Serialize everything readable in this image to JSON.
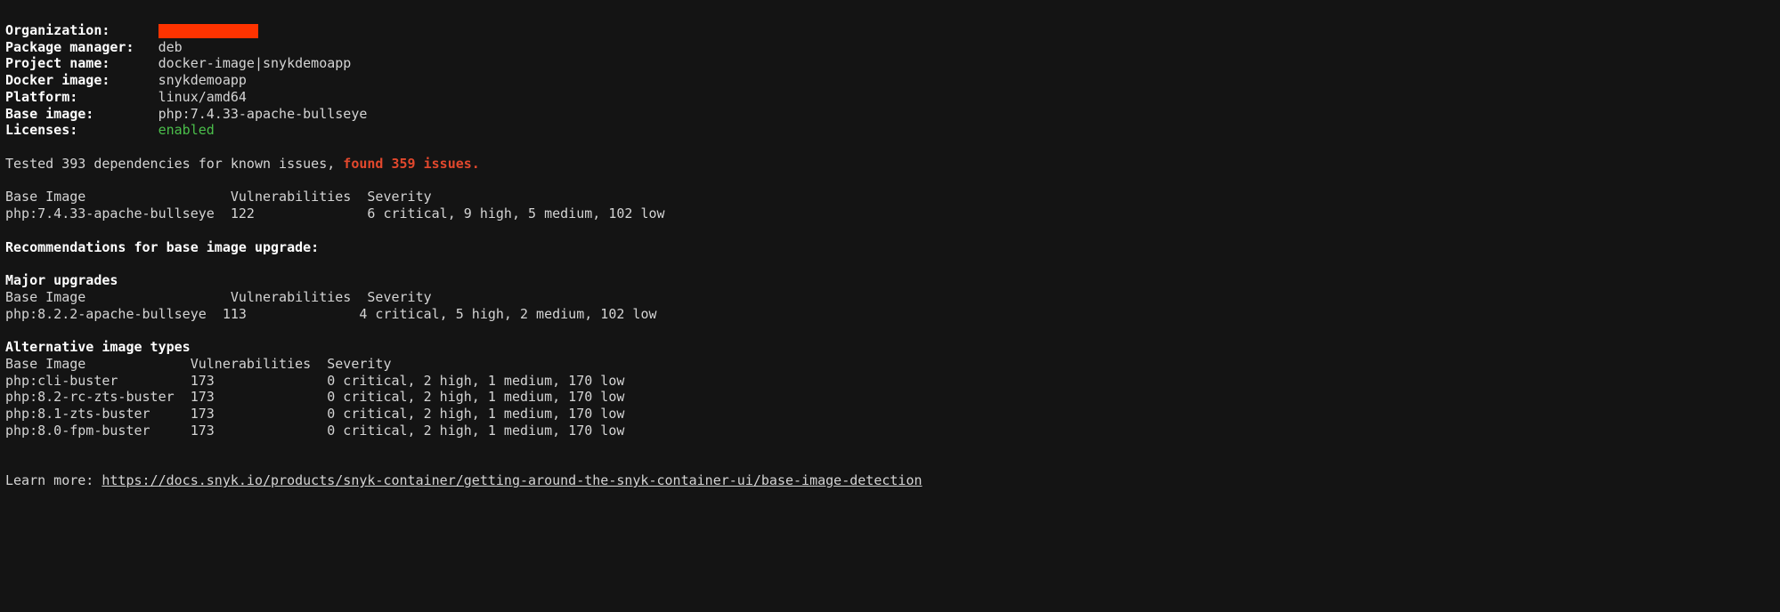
{
  "metadata": {
    "labels": {
      "organization": "Organization:",
      "package_manager": "Package manager:",
      "project_name": "Project name:",
      "docker_image": "Docker image:",
      "platform": "Platform:",
      "base_image": "Base image:",
      "licenses": "Licenses:"
    },
    "values": {
      "organization_redacted": true,
      "package_manager": "deb",
      "project_name": "docker-image|snykdemoapp",
      "docker_image": "snykdemoapp",
      "platform": "linux/amd64",
      "base_image": "php:7.4.33-apache-bullseye",
      "licenses": "enabled"
    }
  },
  "summary": {
    "tested_prefix": "Tested 393 dependencies for known issues, ",
    "found_issues": "found 359 issues."
  },
  "current_base": {
    "headers": {
      "image": "Base Image",
      "vulns": "Vulnerabilities",
      "severity": "Severity"
    },
    "row": {
      "image": "php:7.4.33-apache-bullseye",
      "vulns": "122",
      "severity": "6 critical, 9 high, 5 medium, 102 low"
    }
  },
  "recommendations_heading": "Recommendations for base image upgrade:",
  "major_upgrades": {
    "heading": "Major upgrades",
    "headers": {
      "image": "Base Image",
      "vulns": "Vulnerabilities",
      "severity": "Severity"
    },
    "row": {
      "image": "php:8.2.2-apache-bullseye",
      "vulns": "113",
      "severity": "4 critical, 5 high, 2 medium, 102 low"
    }
  },
  "alternatives": {
    "heading": "Alternative image types",
    "headers": {
      "image": "Base Image",
      "vulns": "Vulnerabilities",
      "severity": "Severity"
    },
    "rows": [
      {
        "image": "php:cli-buster",
        "vulns": "173",
        "severity": "0 critical, 2 high, 1 medium, 170 low"
      },
      {
        "image": "php:8.2-rc-zts-buster",
        "vulns": "173",
        "severity": "0 critical, 2 high, 1 medium, 170 low"
      },
      {
        "image": "php:8.1-zts-buster",
        "vulns": "173",
        "severity": "0 critical, 2 high, 1 medium, 170 low"
      },
      {
        "image": "php:8.0-fpm-buster",
        "vulns": "173",
        "severity": "0 critical, 2 high, 1 medium, 170 low"
      }
    ]
  },
  "learn_more": {
    "label": "Learn more: ",
    "url": "https://docs.snyk.io/products/snyk-container/getting-around-the-snyk-container-ui/base-image-detection"
  }
}
